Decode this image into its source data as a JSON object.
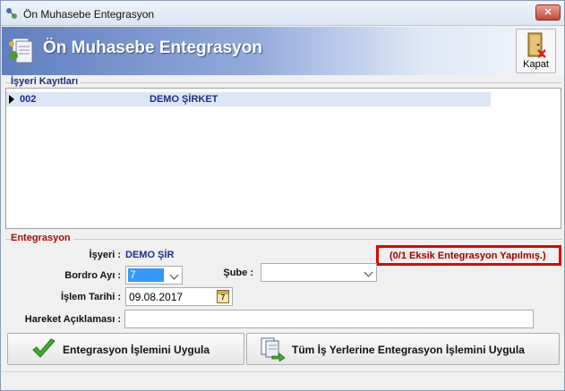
{
  "window": {
    "title": "Ön Muhasebe Entegrasyon"
  },
  "header": {
    "title": "Ön Muhasebe Entegrasyon",
    "close_label": "Kapat"
  },
  "employer_records": {
    "group_label": "İşyeri Kayıtları",
    "rows": [
      {
        "code": "002",
        "name": "DEMO ŞİRKET"
      }
    ]
  },
  "integration": {
    "group_label": "Entegrasyon",
    "employer_label": "İşyeri :",
    "employer_value": "DEMO ŞİR",
    "status_message": "(0/1 Eksik Entegrasyon Yapılmış.)",
    "payroll_month_label": "Bordro Ayı :",
    "payroll_month_value": "7",
    "branch_label": "Şube :",
    "branch_value": "",
    "transaction_date_label": "İşlem Tarihi :",
    "transaction_date_value": "09.08.2017",
    "calendar_day": "7",
    "description_label": "Hareket Açıklaması :",
    "description_value": ""
  },
  "actions": {
    "apply_label": "Entegrasyon İşlemini Uygula",
    "apply_all_label": "Tüm İş Yerlerine Entegrasyon İşlemini Uygula"
  },
  "colors": {
    "status_red": "#e00000",
    "link_blue": "#1a2f8a",
    "selection_blue": "#3399ff"
  }
}
